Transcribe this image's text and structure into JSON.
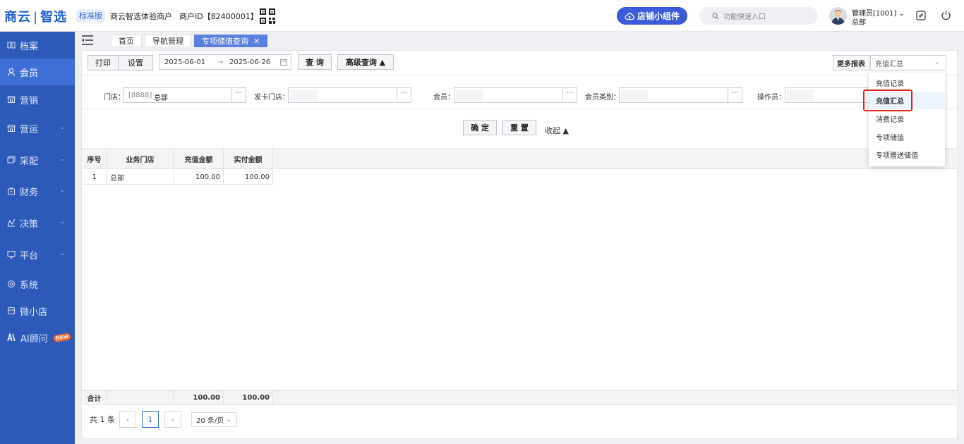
{
  "header": {
    "logo_left": "商云",
    "logo_right": "智选",
    "edition": "标准版",
    "merchant_name": "商云智选体验商户",
    "merchant_id": "商户ID【82400001】",
    "widget_button": "店铺小组件",
    "search_placeholder": "功能快速入口",
    "user_name": "管理员[1001]",
    "user_store": "总部"
  },
  "sidebar": {
    "items": [
      {
        "label": "档案"
      },
      {
        "label": "会员"
      },
      {
        "label": "营销"
      },
      {
        "label": "营运"
      },
      {
        "label": "采配"
      },
      {
        "label": "财务"
      },
      {
        "label": "决策"
      },
      {
        "label": "平台"
      },
      {
        "label": "系统"
      },
      {
        "label": "微小店"
      },
      {
        "label": "AI顾问"
      }
    ],
    "new_badge": "NEW"
  },
  "tabs": [
    {
      "label": "首页"
    },
    {
      "label": "导航管理"
    },
    {
      "label": "专项储值查询"
    }
  ],
  "toolbar": {
    "print": "打印",
    "settings": "设置",
    "date_from": "2025-06-01",
    "date_to": "2025-06-26",
    "date_arrow": "→",
    "query": "查 询",
    "advanced": "高级查询 ▲",
    "more_reports": "更多报表",
    "report_selected": "充值汇总"
  },
  "filters": {
    "store_label": "门店：",
    "store_code": "[8888]",
    "store_value": "总部",
    "card_store_label": "发卡门店：",
    "member_label": "会员：",
    "member_type_label": "会员类别：",
    "operator_label": "操作员：",
    "dots": "···"
  },
  "actions": {
    "confirm": "确 定",
    "reset": "重 置",
    "collapse": "收起 ▲"
  },
  "table": {
    "headers": [
      "序号",
      "业务门店",
      "充值金额",
      "实付金额"
    ],
    "rows": [
      {
        "no": "1",
        "store": "总部",
        "charge": "100.00",
        "paid": "100.00"
      }
    ],
    "footer": {
      "label": "合计",
      "charge": "100.00",
      "paid": "100.00"
    }
  },
  "pager": {
    "total": "共 1 条",
    "prev": "‹",
    "current": "1",
    "next": "›",
    "page_size": "20 条/页"
  },
  "dropdown": {
    "items": [
      "充值记录",
      "充值汇总",
      "消费记录",
      "专项储值",
      "专项赠送储值"
    ]
  },
  "colors": {
    "sidebar": "#2d59b8",
    "accent": "#3b5bdb",
    "highlight": "#e0241b"
  }
}
